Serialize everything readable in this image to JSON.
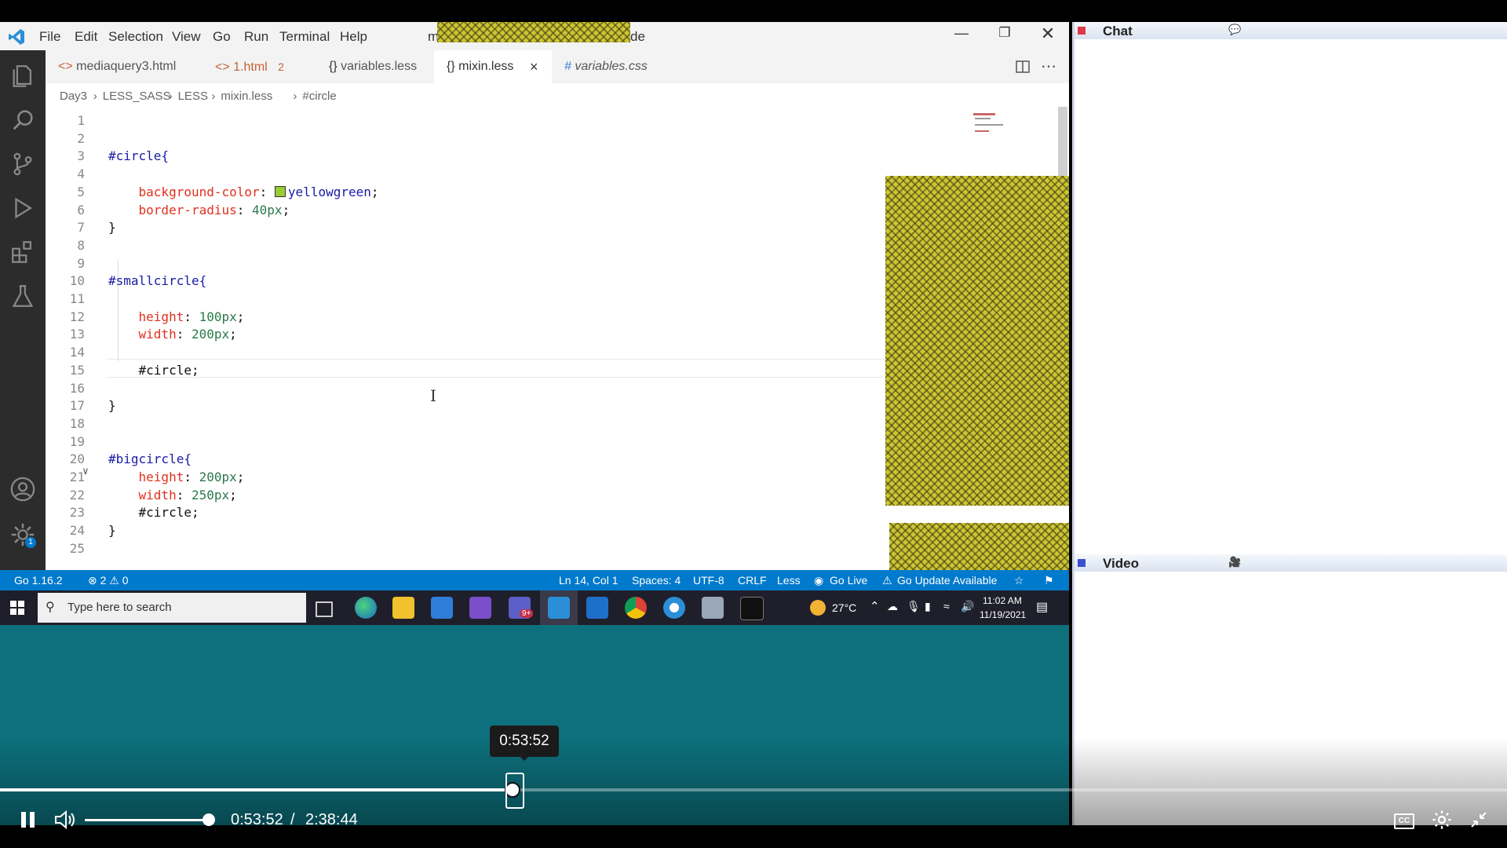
{
  "menu": [
    "File",
    "Edit",
    "Selection",
    "View",
    "Go",
    "Run",
    "Terminal",
    "Help"
  ],
  "window_title_suffix": "de",
  "window_title_prefix": "m",
  "tabs": [
    {
      "icon": "<>",
      "label": "mediaquery3.html"
    },
    {
      "icon": "<>",
      "label": "1.html",
      "badge": "2"
    },
    {
      "icon": "{}",
      "label": "variables.less"
    },
    {
      "icon": "{}",
      "label": "mixin.less",
      "close": "×"
    },
    {
      "icon": "#",
      "label": "variables.css"
    }
  ],
  "breadcrumb": [
    "Day3",
    "LESS_SASS",
    "LESS",
    "mixin.less",
    "#circle"
  ],
  "code_lines": [
    {
      "n": "1",
      "segs": []
    },
    {
      "n": "2",
      "segs": []
    },
    {
      "n": "3",
      "segs": [
        {
          "c": "kw",
          "t": "#circle{"
        }
      ]
    },
    {
      "n": "4",
      "segs": []
    },
    {
      "n": "5",
      "segs": [
        {
          "c": "prop",
          "t": "    background-color"
        },
        {
          "c": "",
          "t": ": "
        },
        {
          "c": "swatch",
          "t": ""
        },
        {
          "c": "kw",
          "t": "yellowgreen"
        },
        {
          "c": "",
          "t": ";"
        }
      ]
    },
    {
      "n": "6",
      "segs": [
        {
          "c": "prop",
          "t": "    border-radius"
        },
        {
          "c": "",
          "t": ": "
        },
        {
          "c": "val",
          "t": "40px"
        },
        {
          "c": "",
          "t": ";"
        }
      ]
    },
    {
      "n": "7",
      "segs": [
        {
          "c": "",
          "t": "}"
        }
      ]
    },
    {
      "n": "8",
      "segs": []
    },
    {
      "n": "9",
      "segs": []
    },
    {
      "n": "10",
      "segs": [
        {
          "c": "kw",
          "t": "#smallcircle{"
        }
      ]
    },
    {
      "n": "11",
      "segs": []
    },
    {
      "n": "12",
      "segs": [
        {
          "c": "prop",
          "t": "    height"
        },
        {
          "c": "",
          "t": ": "
        },
        {
          "c": "val",
          "t": "100px"
        },
        {
          "c": "",
          "t": ";"
        }
      ]
    },
    {
      "n": "13",
      "segs": [
        {
          "c": "prop",
          "t": "    width"
        },
        {
          "c": "",
          "t": ": "
        },
        {
          "c": "val",
          "t": "200px"
        },
        {
          "c": "",
          "t": ";"
        }
      ]
    },
    {
      "n": "14",
      "segs": []
    },
    {
      "n": "15",
      "segs": [
        {
          "c": "",
          "t": "    #circle;"
        }
      ]
    },
    {
      "n": "16",
      "segs": []
    },
    {
      "n": "17",
      "segs": [
        {
          "c": "",
          "t": "}"
        }
      ]
    },
    {
      "n": "18",
      "segs": []
    },
    {
      "n": "19",
      "segs": []
    },
    {
      "n": "20",
      "segs": [
        {
          "c": "kw",
          "t": "#bigcircle{"
        }
      ]
    },
    {
      "n": "21",
      "segs": [
        {
          "c": "prop",
          "t": "    height"
        },
        {
          "c": "",
          "t": ": "
        },
        {
          "c": "val",
          "t": "200px"
        },
        {
          "c": "",
          "t": ";"
        }
      ]
    },
    {
      "n": "22",
      "segs": [
        {
          "c": "prop",
          "t": "    width"
        },
        {
          "c": "",
          "t": ": "
        },
        {
          "c": "val",
          "t": "250px"
        },
        {
          "c": "",
          "t": ";"
        }
      ]
    },
    {
      "n": "23",
      "segs": [
        {
          "c": "",
          "t": "    #circle;"
        }
      ]
    },
    {
      "n": "24",
      "segs": [
        {
          "c": "",
          "t": "}"
        }
      ]
    },
    {
      "n": "25",
      "segs": []
    }
  ],
  "status": {
    "go_version": "Go 1.16.2",
    "problems": "⊗ 2 ⚠ 0",
    "position": "Ln 14, Col 1",
    "spaces": "Spaces: 4",
    "encoding": "UTF-8",
    "eol": "CRLF",
    "language": "Less",
    "go_live": "Go Live",
    "update": "Go Update Available"
  },
  "taskbar": {
    "search_placeholder": "Type here to search",
    "weather": "27°C",
    "time": "11:02 AM",
    "date": "11/19/2021",
    "teams_badge": "9+"
  },
  "panels": {
    "chat": "Chat",
    "video": "Video"
  },
  "player": {
    "tooltip": "0:53:52",
    "current": "0:53:52",
    "separator": "/",
    "duration": "2:38:44",
    "progress_fraction": 0.34
  },
  "colors": {
    "accent": "#007acc",
    "teal": "#0d707c",
    "swatch": "#9acd32"
  }
}
